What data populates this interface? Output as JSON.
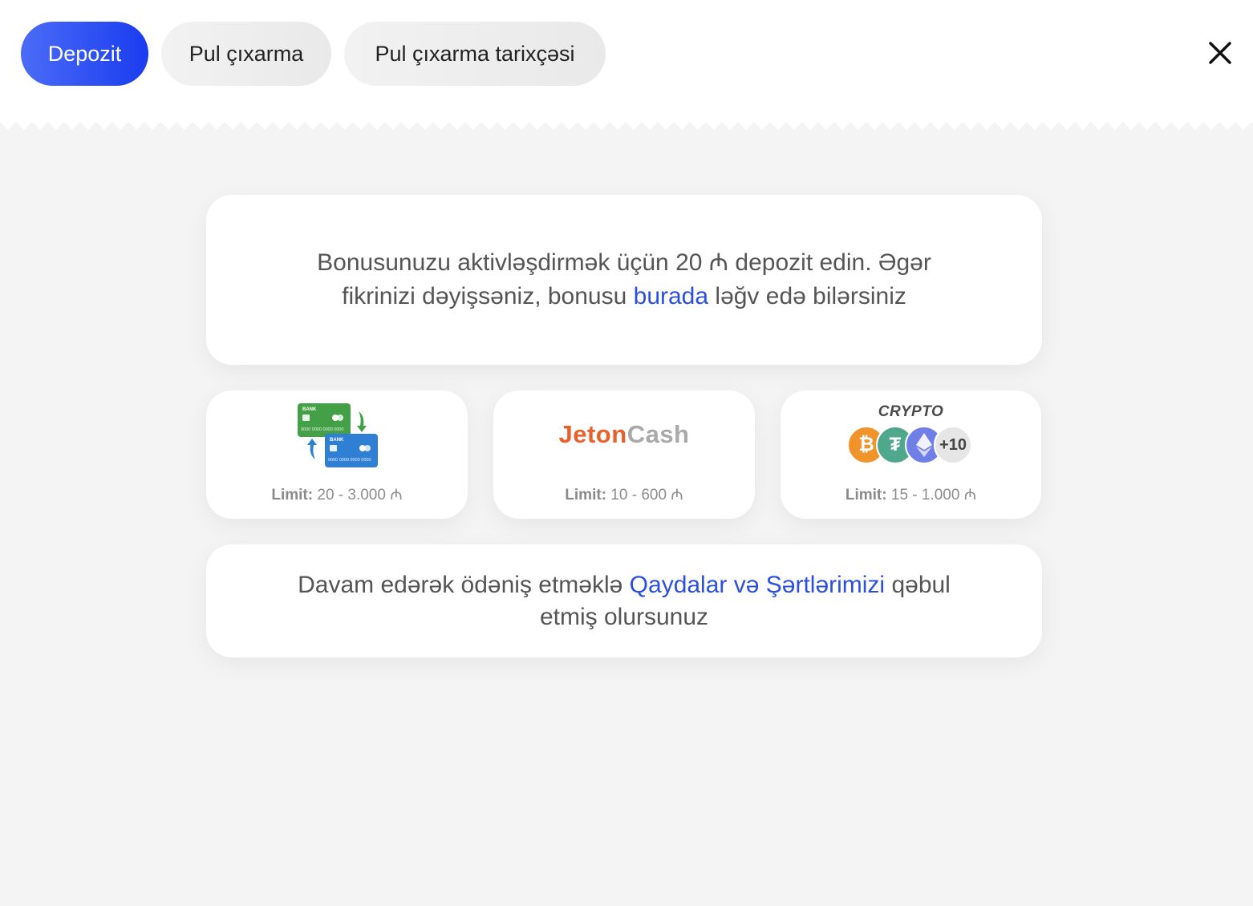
{
  "tabs": {
    "deposit": "Depozit",
    "withdraw": "Pul çıxarma",
    "history": "Pul çıxarma tarixçəsi"
  },
  "bonus": {
    "text_before": "Bonusunuzu aktivləşdirmək üçün 20 ₼ depozit edin. Əgər fikrinizi dəyişsəniz, bonusu ",
    "link": "burada",
    "text_after": " ləğv edə bilərsiniz"
  },
  "methods": [
    {
      "name": "Bank cards",
      "icon": "bank-cards-transfer-icon",
      "limit_label": "Limit:",
      "limit_value": " 20 - 3.000 ₼"
    },
    {
      "name": "JetonCash",
      "logo_part1": "Jeton",
      "logo_part2": "Cash",
      "limit_label": "Limit:",
      "limit_value": " 10 - 600 ₼"
    },
    {
      "name": "Crypto",
      "label": "CRYPTO",
      "more": "+10",
      "limit_label": "Limit:",
      "limit_value": " 15 - 1.000 ₼"
    }
  ],
  "terms": {
    "text_before": "Davam edərək ödəniş etməklə ",
    "link": "Qaydalar və Şərtlərimizi",
    "text_after": " qəbul etmiş olursunuz"
  },
  "colors": {
    "accent": "#2b4fe0",
    "active_tab_start": "#4b6cf6",
    "active_tab_end": "#1a3cf0",
    "jeton_orange": "#e8602c",
    "bitcoin": "#f0932b",
    "tether": "#50a88c",
    "ethereum": "#6f7fe6"
  }
}
